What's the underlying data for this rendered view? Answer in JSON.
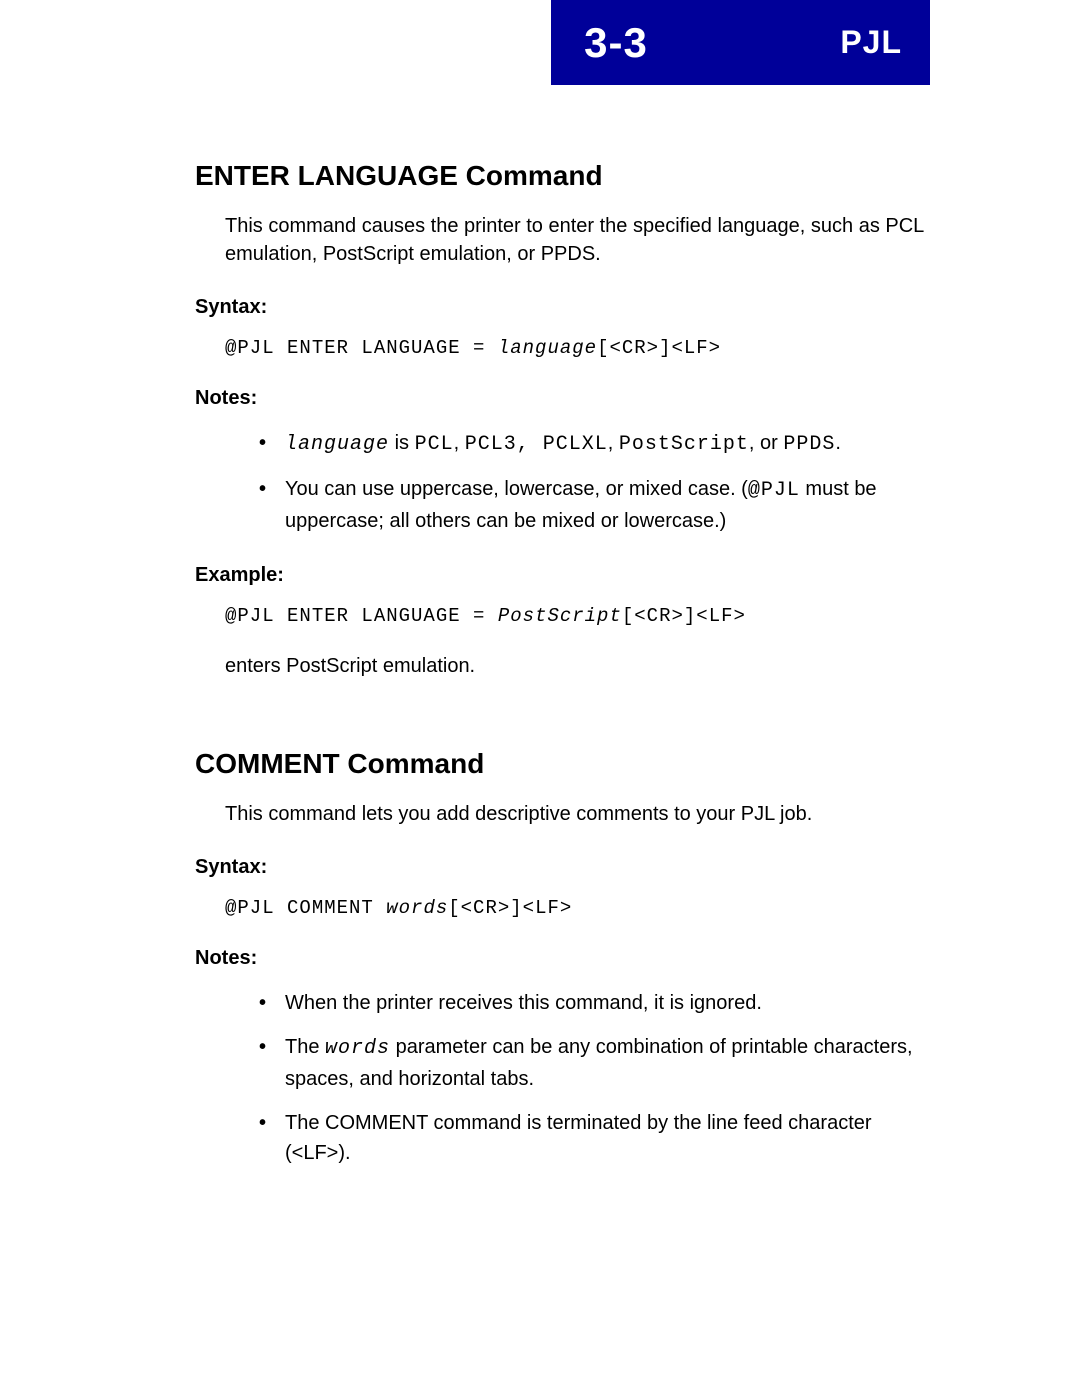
{
  "header": {
    "page_number": "3-3",
    "title": "PJL"
  },
  "section1": {
    "heading": "ENTER LANGUAGE Command",
    "intro": "This command causes the printer to enter the specified language, such as PCL emulation, PostScript emulation, or PPDS.",
    "syntax_label": "Syntax:",
    "syntax_prefix": "@PJL ENTER LANGUAGE = ",
    "syntax_var": "language",
    "syntax_suffix": "[<CR>]<LF>",
    "notes_label": "Notes:",
    "note1_var": "language",
    "note1_mid": " is ",
    "note1_opt1": "PCL",
    "note1_sep1": ", ",
    "note1_opt2": "PCL3, PCLXL",
    "note1_sep2": ", ",
    "note1_opt3": "PostScript",
    "note1_sep3": ", or ",
    "note1_opt4": "PPDS",
    "note1_end": ".",
    "note2_a": "You can use uppercase, lowercase, or mixed case. (",
    "note2_code": "@PJL",
    "note2_b": " must be uppercase; all others can be mixed or lowercase.)",
    "example_label": "Example:",
    "example_prefix": "@PJL ENTER LANGUAGE = ",
    "example_var": "PostScript",
    "example_suffix": "[<CR>]<LF>",
    "example_result": "enters PostScript emulation."
  },
  "section2": {
    "heading": "COMMENT Command",
    "intro": "This command lets you add descriptive comments to your PJL job.",
    "syntax_label": "Syntax:",
    "syntax_prefix": "@PJL COMMENT ",
    "syntax_var": "words",
    "syntax_suffix": "[<CR>]<LF>",
    "notes_label": "Notes:",
    "note1": "When the printer receives this command, it is ignored.",
    "note2_a": "The ",
    "note2_var": "words",
    "note2_b": " parameter can be any combination of printable characters, spaces, and horizontal tabs.",
    "note3": "The COMMENT command is terminated by the line feed character (<LF>)."
  }
}
